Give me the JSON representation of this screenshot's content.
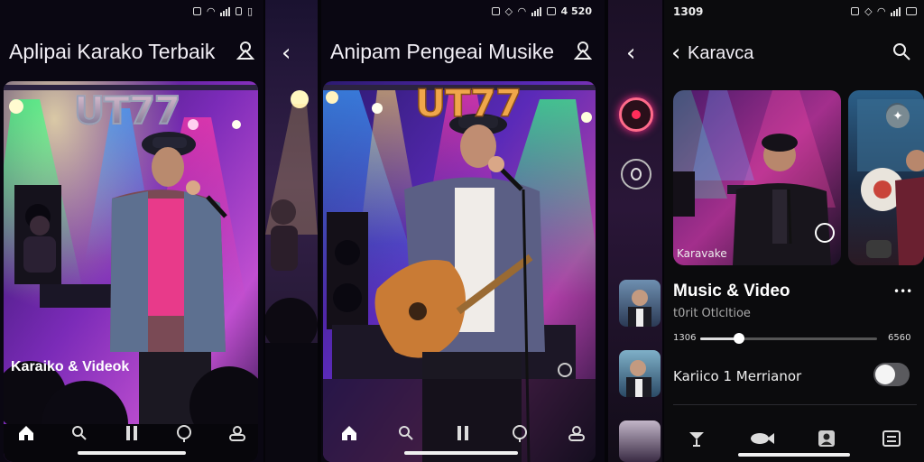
{
  "status": {
    "left_panel_right": "",
    "right_panel_time": "1309",
    "mid_panel_right": "4 520"
  },
  "screen1": {
    "title": "Aplipai Karako Terbaik",
    "logo": "UT77",
    "caption": "Karaiko & Videok",
    "nav": [
      "home-icon",
      "search-icon",
      "pause-icon",
      "mic-icon",
      "profile-icon"
    ]
  },
  "screen2": {
    "title": "Anipam Pengeai Musike",
    "logo": "UT77",
    "nav": [
      "home-icon",
      "search-icon",
      "pause-icon",
      "mic-icon",
      "profile-icon"
    ]
  },
  "screen3": {
    "title": "Karavca",
    "card_label": "Karavake",
    "section_title": "Music & Video",
    "section_subtitle": "t0rit Otlcltioe",
    "time_start": "1306",
    "time_end": "6560",
    "progress": 0.22,
    "toggle_label": "Kariico 1 Merrianor",
    "toggle_on": false,
    "more": "•••",
    "nav": [
      "cocktail-icon",
      "fish-icon",
      "contact-icon",
      "list-icon"
    ]
  },
  "colors": {
    "accent_pink": "#ff2d8a",
    "logo_gold": "#f0a64a",
    "stage_purple": "#6a2fc4",
    "stage_blue": "#1e6cff"
  }
}
